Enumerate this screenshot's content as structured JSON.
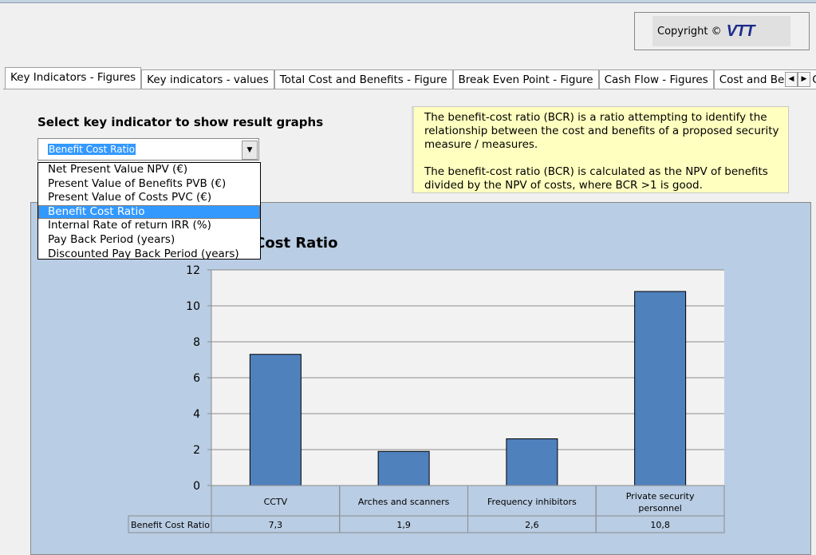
{
  "copyright": {
    "label": "Copyright ©",
    "logo": "VTT"
  },
  "tabs": [
    "Key Indicators - Figures",
    "Key indicators - values",
    "Total Cost and Benefits - Figure",
    "Break Even Point - Figure",
    "Cash Flow - Figures",
    "Cost and Benefit Cate"
  ],
  "heading": "Select key indicator to show result graphs",
  "combo": {
    "value": "Benefit Cost Ratio",
    "options": [
      "Net Present Value NPV (€)",
      "Present Value of Benefits PVB (€)",
      "Present Value of Costs PVC (€)",
      "Benefit Cost Ratio",
      "Internal Rate of return IRR (%)",
      "Pay Back Period (years)",
      "Discounted Pay Back Period (years)"
    ]
  },
  "info": {
    "p1": "The benefit-cost ratio (BCR) is a ratio attempting to identify the relationship between the cost and benefits of a proposed  security measure / measures.",
    "p2": "The benefit-cost ratio (BCR) is calculated as the NPV of benefits divided by the NPV of costs, where BCR >1 is good."
  },
  "chart_data": {
    "type": "bar",
    "title": "Benefit Cost Ratio",
    "categories": [
      "CCTV",
      "Arches and scanners",
      "Frequency inhibitors",
      "Private security personnel"
    ],
    "series": [
      {
        "name": "Benefit Cost Ratio",
        "values": [
          7.3,
          1.9,
          2.6,
          10.8
        ],
        "labels": [
          "7,3",
          "1,9",
          "2,6",
          "10,8"
        ]
      }
    ],
    "ylim": [
      0,
      12
    ],
    "yticks": [
      0,
      2,
      4,
      6,
      8,
      10,
      12
    ],
    "grid": true,
    "color": "#4f81bd"
  }
}
